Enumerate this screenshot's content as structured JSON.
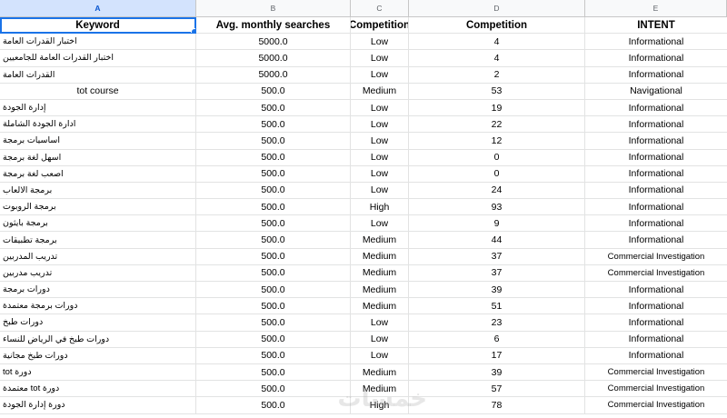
{
  "columns": [
    "A",
    "B",
    "C",
    "D",
    "E"
  ],
  "headers": [
    "Keyword",
    "Avg. monthly searches",
    "Competition",
    "Competition",
    "INTENT"
  ],
  "rows": [
    [
      "اختبار القدرات العامة",
      "5000.0",
      "Low",
      "4",
      "Informational"
    ],
    [
      "اختبار القدرات العامة للجامعيين",
      "5000.0",
      "Low",
      "4",
      "Informational"
    ],
    [
      "القدرات العامة",
      "5000.0",
      "Low",
      "2",
      "Informational"
    ],
    [
      "tot course",
      "500.0",
      "Medium",
      "53",
      "Navigational"
    ],
    [
      "إدارة الجودة",
      "500.0",
      "Low",
      "19",
      "Informational"
    ],
    [
      "ادارة الجودة الشاملة",
      "500.0",
      "Low",
      "22",
      "Informational"
    ],
    [
      "اساسيات برمجة",
      "500.0",
      "Low",
      "12",
      "Informational"
    ],
    [
      "اسهل لغة برمجة",
      "500.0",
      "Low",
      "0",
      "Informational"
    ],
    [
      "اصعب لغة برمجة",
      "500.0",
      "Low",
      "0",
      "Informational"
    ],
    [
      "برمجة الالعاب",
      "500.0",
      "Low",
      "24",
      "Informational"
    ],
    [
      "برمجة الروبوت",
      "500.0",
      "High",
      "93",
      "Informational"
    ],
    [
      "برمجة بايثون",
      "500.0",
      "Low",
      "9",
      "Informational"
    ],
    [
      "برمجة تطبيقات",
      "500.0",
      "Medium",
      "44",
      "Informational"
    ],
    [
      "تدريب المدربين",
      "500.0",
      "Medium",
      "37",
      "Commercial Investigation"
    ],
    [
      "تدريب مدربين",
      "500.0",
      "Medium",
      "37",
      "Commercial Investigation"
    ],
    [
      "دورات برمجة",
      "500.0",
      "Medium",
      "39",
      "Informational"
    ],
    [
      "دورات برمجة معتمدة",
      "500.0",
      "Medium",
      "51",
      "Informational"
    ],
    [
      "دورات طبخ",
      "500.0",
      "Low",
      "23",
      "Informational"
    ],
    [
      "دورات طبخ في الرياض للنساء",
      "500.0",
      "Low",
      "6",
      "Informational"
    ],
    [
      "دورات طبخ مجانية",
      "500.0",
      "Low",
      "17",
      "Informational"
    ],
    [
      "دورة tot",
      "500.0",
      "Medium",
      "39",
      "Commercial Investigation"
    ],
    [
      "دورة tot معتمدة",
      "500.0",
      "Medium",
      "57",
      "Commercial Investigation"
    ],
    [
      "دورة إدارة الجودة",
      "500.0",
      "High",
      "78",
      "Commercial Investigation"
    ]
  ],
  "watermark": "خمسات"
}
